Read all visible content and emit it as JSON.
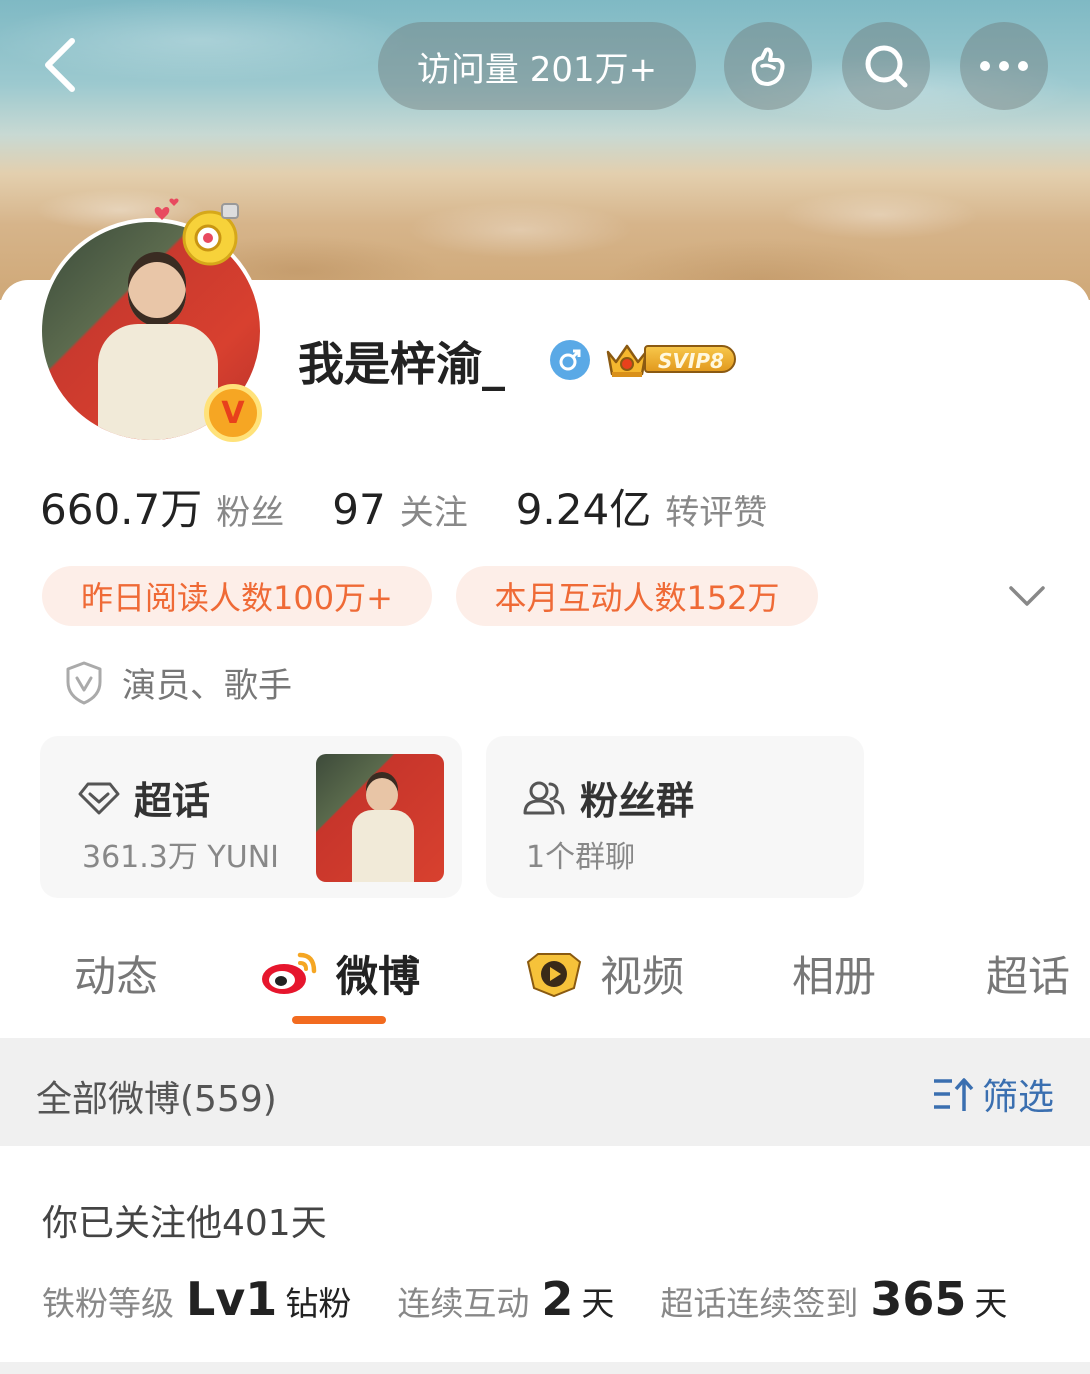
{
  "header": {
    "visits_label": "访问量 201万+",
    "icons": [
      "back-icon",
      "gift-icon",
      "search-icon",
      "more-icon"
    ]
  },
  "profile": {
    "name": "我是梓渝_",
    "gender_icon": "male-icon",
    "svip_label": "SVIP8",
    "verified_badge": "V",
    "stats": [
      {
        "value": "660.7万",
        "label": "粉丝"
      },
      {
        "value": "97",
        "label": "关注"
      },
      {
        "value": "9.24亿",
        "label": "转评赞"
      }
    ],
    "tags": [
      "昨日阅读人数100万+",
      "本月互动人数152万"
    ],
    "role": "演员、歌手"
  },
  "cards": {
    "supertopic": {
      "title": "超话",
      "subtitle": "361.3万 YUNI"
    },
    "fan_group": {
      "title": "粉丝群",
      "subtitle": "1个群聊"
    }
  },
  "tabs": [
    {
      "label": "动态",
      "active": false
    },
    {
      "label": "微博",
      "active": true
    },
    {
      "label": "视频",
      "active": false
    },
    {
      "label": "相册",
      "active": false
    },
    {
      "label": "超话",
      "active": false
    }
  ],
  "filter": {
    "all_label": "全部微博(559)",
    "filter_label": "筛选"
  },
  "follow": {
    "days_text": "你已关注他401天",
    "fan_level_label": "铁粉等级",
    "fan_level_value": "Lv1",
    "fan_level_unit": "钻粉",
    "interact_label": "连续互动",
    "interact_value": "2",
    "interact_unit": "天",
    "checkin_label": "超话连续签到",
    "checkin_value": "365",
    "checkin_unit": "天"
  },
  "colors": {
    "accent_orange": "#f26b1f",
    "tag_text": "#ef6a36",
    "tag_bg": "#fdeee8",
    "filter_blue": "#3a6fb0"
  }
}
